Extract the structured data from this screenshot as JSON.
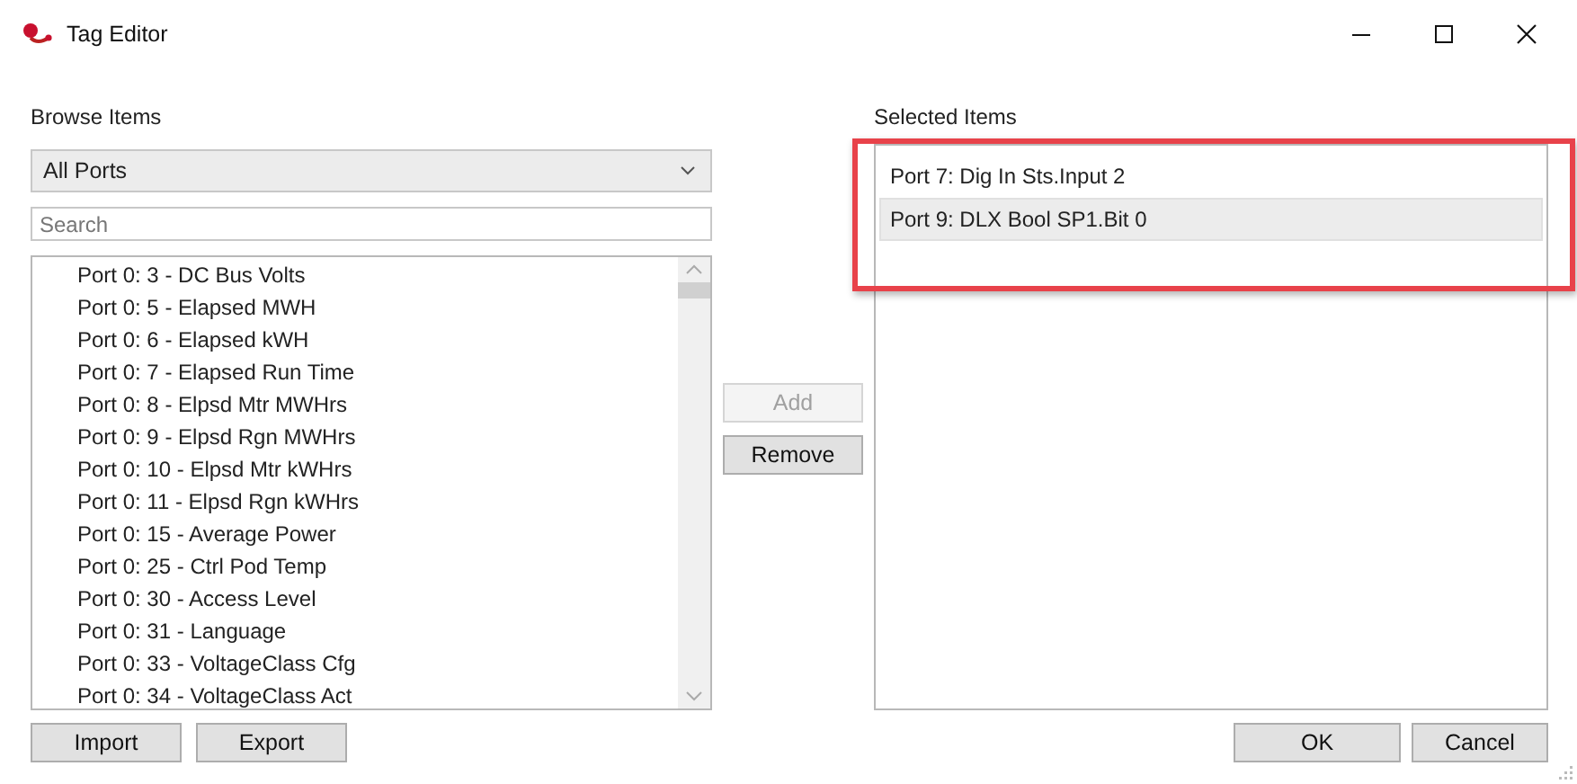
{
  "window": {
    "title": "Tag Editor"
  },
  "browse": {
    "label": "Browse Items",
    "dropdown": "All Ports",
    "search": {
      "placeholder": "Search"
    },
    "items": [
      "Port 0: 3 - DC Bus Volts",
      "Port 0: 5 - Elapsed MWH",
      "Port 0: 6 - Elapsed kWH",
      "Port 0: 7 - Elapsed Run Time",
      "Port 0: 8 - Elpsd Mtr MWHrs",
      "Port 0: 9 - Elpsd Rgn MWHrs",
      "Port 0: 10 - Elpsd Mtr kWHrs",
      "Port 0: 11 - Elpsd Rgn kWHrs",
      "Port 0: 15 - Average Power",
      "Port 0: 25 - Ctrl Pod Temp",
      "Port 0: 30 - Access Level",
      "Port 0: 31 - Language",
      "Port 0: 33 - VoltageClass Cfg",
      "Port 0: 34 - VoltageClass Act"
    ]
  },
  "middle_buttons": [
    {
      "label": "Add",
      "disabled": true
    },
    {
      "label": "Remove",
      "disabled": false
    }
  ],
  "selected": {
    "label": "Selected Items",
    "items": [
      {
        "text": "Port 7: Dig In Sts.Input 2",
        "selected": false
      },
      {
        "text": "Port 9: DLX Bool SP1.Bit 0",
        "selected": true
      }
    ]
  },
  "left_buttons": [
    "Import",
    "Export"
  ],
  "dialog_buttons": [
    "OK",
    "Cancel"
  ],
  "annotation": {
    "kind": "rectangle"
  }
}
